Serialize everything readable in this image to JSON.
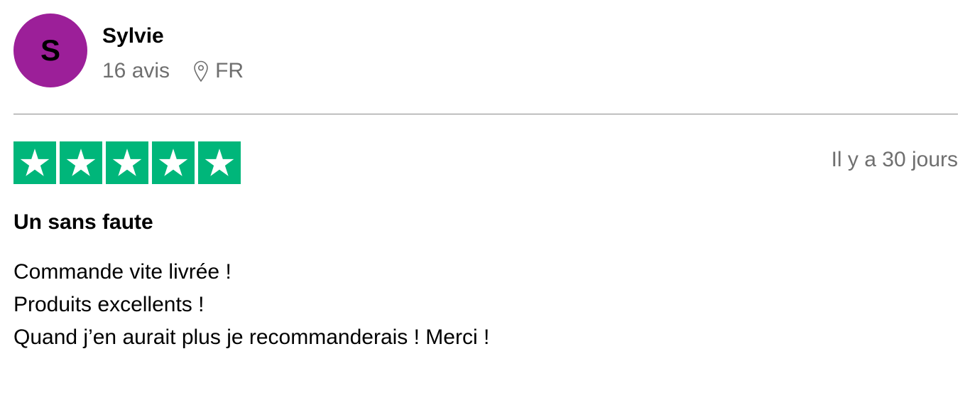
{
  "reviewer": {
    "initial": "S",
    "avatar_color": "#9c1f99",
    "name": "Sylvie",
    "review_count": "16 avis",
    "location_icon": "map-pin-icon",
    "country": "FR"
  },
  "review": {
    "rating": 5,
    "max_rating": 5,
    "star_icon": "star-icon",
    "star_color": "#00b67a",
    "date": "Il y a 30 jours",
    "title": "Un sans faute",
    "lines": [
      "Commande vite livrée !",
      "Produits excellents !",
      "Quand j’en aurait plus je recommanderais ! Merci !"
    ]
  }
}
